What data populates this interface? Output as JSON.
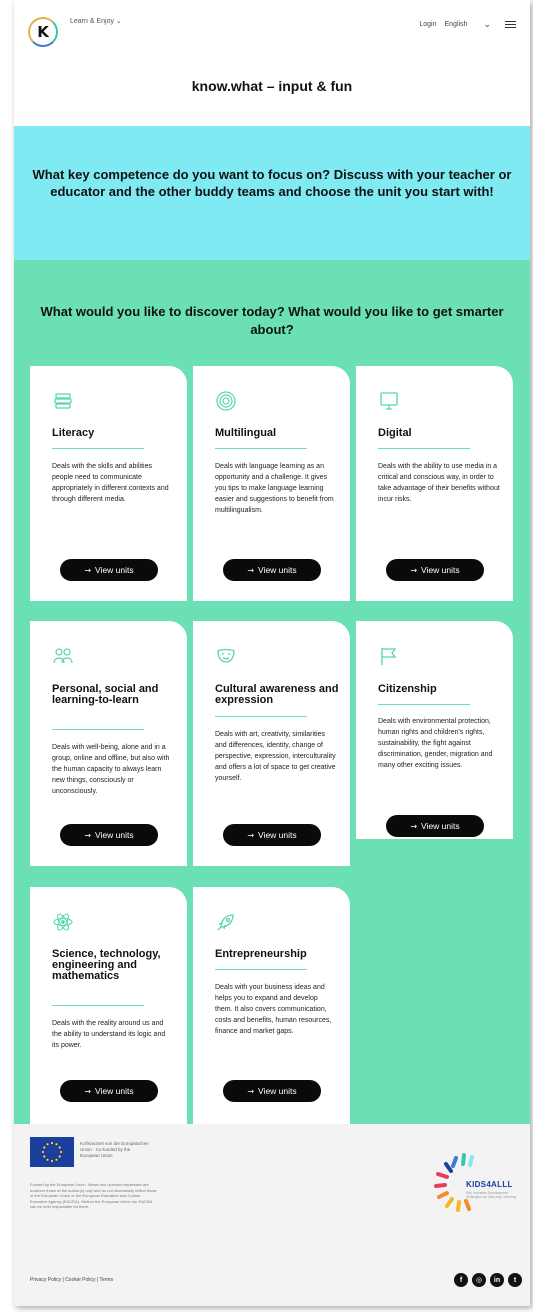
{
  "header": {
    "logo_letter": "K",
    "tagline": "Learn & Enjoy ⌄",
    "login": "Login",
    "language": "English",
    "site_title": "know.what – input & fun"
  },
  "intro": {
    "text": "What key competence do you want to focus on? Discuss with your teacher or educator and the other buddy teams and choose the unit you start with!"
  },
  "question": "What would you like to discover today? What would you like to get smarter about?",
  "button_label": "View units",
  "cards": [
    {
      "title": "Literacy",
      "icon": "book-stack-icon",
      "desc": "Deals with the skills and abilities people need to communicate appropriately in different contexts and through different media."
    },
    {
      "title": "Multilingual",
      "icon": "target-rings-icon",
      "desc": "Deals with language learning as an opportunity and a challenge. It gives you tips to make language learning easier and suggestions to benefit from multilingualism."
    },
    {
      "title": "Digital",
      "icon": "monitor-icon",
      "desc": "Deals with the ability to use media in a critical and conscious way, in order to take advantage of their benefits without incur risks."
    },
    {
      "title": "Personal, social and learning-to-learn",
      "icon": "people-group-icon",
      "desc": "Deals with well-being, alone and in a group, online and offline, but also with the human capacity to always learn new things, consciously or unconsciously."
    },
    {
      "title": "Cultural awareness and expression",
      "icon": "theater-mask-icon",
      "desc": "Deals with art, creativity, similarities and differences, identity, change of perspective, expression, interculturality and offers a lot of space to get creative yourself."
    },
    {
      "title": "Citizenship",
      "icon": "flag-icon",
      "desc": "Deals with environmental protection, human rights and children's rights, sustainability, the fight against discrimination, gender, migration and many other exciting issues."
    },
    {
      "title": "Science, technology, engineering and mathematics",
      "icon": "atom-icon",
      "desc": "Deals with the reality around us and the ability to understand its logic and its power."
    },
    {
      "title": "Entrepreneurship",
      "icon": "rocket-icon",
      "desc": "Deals with your business ideas and helps you to expand and develop them. It also covers communication, costs and benefits, human resources, finance and market gaps."
    }
  ],
  "footer": {
    "eu_text": "Kofinanziert von der Europäischen Union · Co-funded by the European Union",
    "disclaimer": "Funded by the European Union. Views and opinions expressed are however those of the author(s) only and do not necessarily reflect those of the European Union or the European Education and Culture Executive Agency (EACEA). Neither the European Union nor EACEA can be held responsible for them.",
    "k4a_name": "KIDS4ALLL",
    "k4a_sub": "Key Inclusive Development Strategies for LifeLong Learning",
    "legal": "Privacy Policy | Cookie Policy | Terms",
    "socials": [
      "facebook-icon",
      "instagram-icon",
      "linkedin-icon",
      "twitter-icon"
    ],
    "colors": {
      "accent_green": "#6ae0b4",
      "accent_cyan": "#7feaf2",
      "button": "#0a0a0a"
    }
  }
}
